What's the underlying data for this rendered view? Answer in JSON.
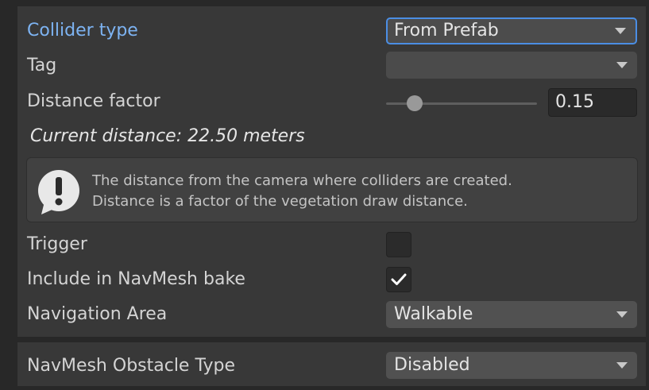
{
  "collider_type": {
    "label": "Collider type",
    "value": "From Prefab"
  },
  "tag": {
    "label": "Tag",
    "value": ""
  },
  "distance_factor": {
    "label": "Distance factor",
    "value": "0.15",
    "slider_fraction": 0.15
  },
  "current_distance": "Current distance: 22.50 meters",
  "help": {
    "icon": "exclamation-icon",
    "line1": "The distance from the camera where colliders are created.",
    "line2": "Distance is a factor of the vegetation draw distance."
  },
  "trigger": {
    "label": "Trigger",
    "checked": false
  },
  "navmesh_bake": {
    "label": "Include in NavMesh bake",
    "checked": true
  },
  "navigation_area": {
    "label": "Navigation Area",
    "value": "Walkable"
  },
  "obstacle_type": {
    "label": "NavMesh Obstacle Type",
    "value": "Disabled"
  },
  "colors": {
    "accent": "#4b8ee4",
    "label_active": "#7db3f2",
    "background": "#383838"
  }
}
